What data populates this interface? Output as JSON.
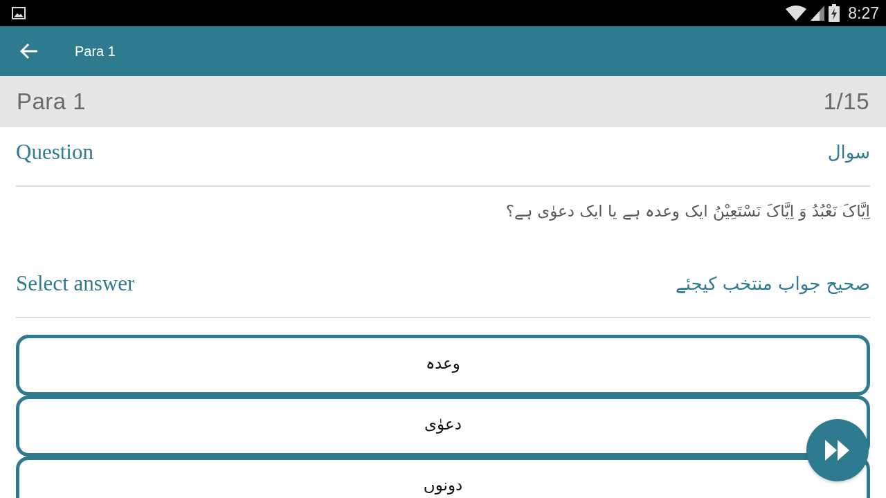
{
  "status_bar": {
    "time": "8:27"
  },
  "app_bar": {
    "title": "Para 1"
  },
  "header": {
    "title": "Para 1",
    "progress": "1/15"
  },
  "question": {
    "label": "Question",
    "label_urdu": "سوال",
    "text": "اِیَّاکَ نَعْبُدُ وَ اِیَّاکَ نَسْتَعِیْنُ ایک وعدہ ہے یا ایک دعوٰی ہے؟"
  },
  "answer": {
    "label": "Select answer",
    "label_urdu": "صحیح جواب منتخب کیجئے",
    "options": [
      {
        "text": "وعدہ",
        "selected": false
      },
      {
        "text": "دعوٰی",
        "selected": false
      },
      {
        "text": "دونوں",
        "selected": false
      }
    ]
  }
}
